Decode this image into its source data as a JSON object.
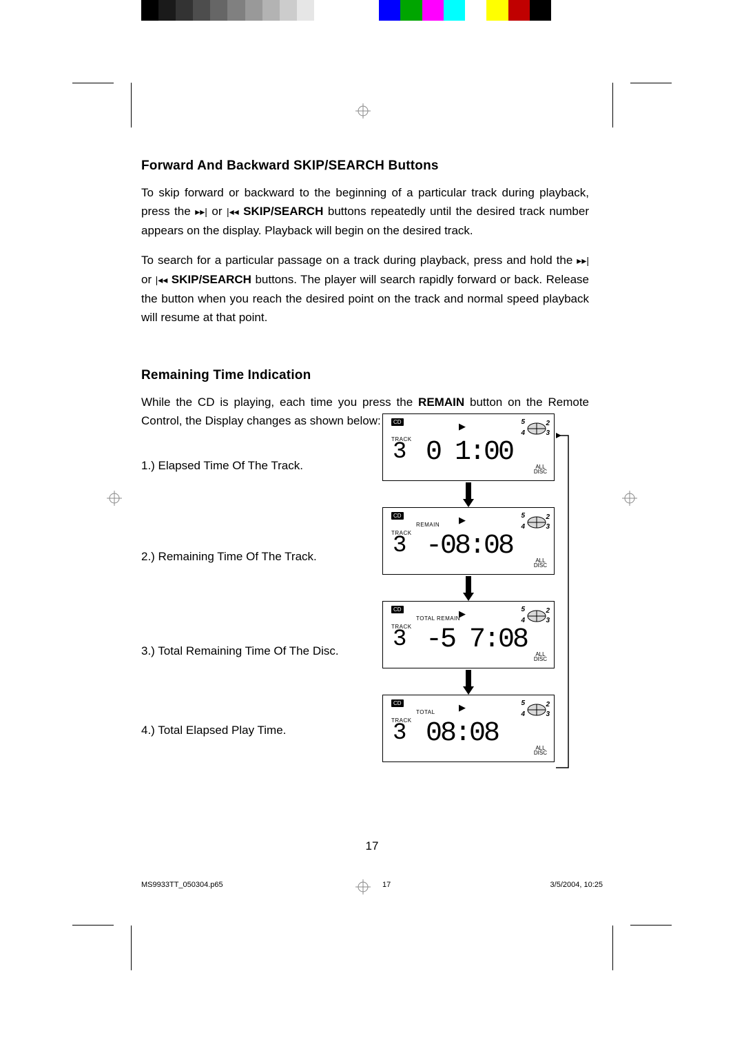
{
  "headings": {
    "h1": "Forward And Backward SKIP/SEARCH Buttons",
    "h2": "Remaining Time Indication"
  },
  "para1a": "To skip forward or backward to the beginning of a particular track during playback, press the ",
  "para1b": " or ",
  "para1c": " SKIP/SEARCH",
  "para1d": " buttons repeatedly until the desired track number appears on the display. Playback will begin on the desired track.",
  "para2a": "To search for a particular passage on a track during playback, press and hold the ",
  "para2b": " or ",
  "para2c": " SKIP/SEARCH",
  "para2d": " buttons. The player will search rapidly forward or back. Release the button when you reach the desired point on the track and normal speed playback will resume at that point.",
  "para3a": "While the CD is playing, each time you press the ",
  "para3b": "REMAIN",
  "para3c": " button on the Remote Control, the Display changes as shown below:",
  "list": {
    "i1": "1.)  Elapsed Time Of The Track.",
    "i2": "2.)  Remaining Time Of The Track.",
    "i3": "3.)  Total Remaining Time Of The Disc.",
    "i4": "4.)  Total Elapsed Play Time."
  },
  "lcd_labels": {
    "cd": "CD",
    "track": "TRACK",
    "all": "ALL",
    "disc": "DISC",
    "remain": "REMAIN",
    "total_remain": "TOTAL REMAIN",
    "total": "TOTAL"
  },
  "lcds": [
    {
      "mode": "",
      "track": "3",
      "time": "0 1:00"
    },
    {
      "mode": "REMAIN",
      "track": "3",
      "time": "-08:08"
    },
    {
      "mode": "TOTAL REMAIN",
      "track": "3",
      "time": "-5 7:08"
    },
    {
      "mode": "TOTAL",
      "track": "3",
      "time": "08:08"
    }
  ],
  "page_number": "17",
  "footer": {
    "file": "MS9933TT_050304.p65",
    "page": "17",
    "date": "3/5/2004, 10:25"
  },
  "color_strip_gray": [
    "#000000",
    "#1a1a1a",
    "#333333",
    "#4d4d4d",
    "#666666",
    "#808080",
    "#999999",
    "#b3b3b3",
    "#cccccc",
    "#e6e6e6",
    "#ffffff"
  ],
  "color_strip_cmyk": [
    "#0000ff",
    "#00a500",
    "#ff00ff",
    "#00ffff",
    "#ffffff",
    "#ffff00",
    "#c00000",
    "#000000"
  ]
}
